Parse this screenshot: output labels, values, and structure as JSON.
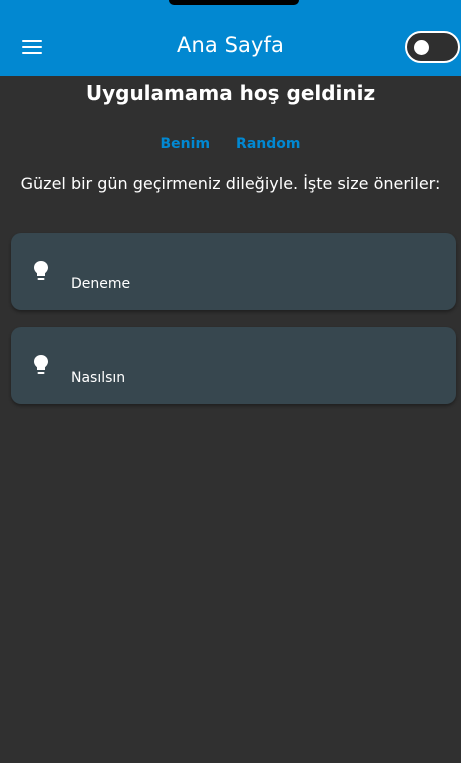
{
  "appbar": {
    "title": "Ana Sayfa",
    "menu_icon": "hamburger-menu-icon",
    "theme_toggle": {
      "state": "off",
      "icon": "toggle-switch-icon"
    }
  },
  "main": {
    "welcome": "Uygulamama hoş geldiniz",
    "tabs": [
      {
        "label": "Benim"
      },
      {
        "label": "Random"
      }
    ],
    "subtitle": "Güzel bir gün geçirmeniz dileğiyle. İşte size öneriler:",
    "suggestions": [
      {
        "icon": "lightbulb-icon",
        "label": "Deneme"
      },
      {
        "icon": "lightbulb-icon",
        "label": "Nasılsın"
      }
    ]
  },
  "colors": {
    "appbar": "#0288D1",
    "background": "#303030",
    "card": "#37474F",
    "accent": "#0288D1",
    "text": "#FFFFFF"
  }
}
